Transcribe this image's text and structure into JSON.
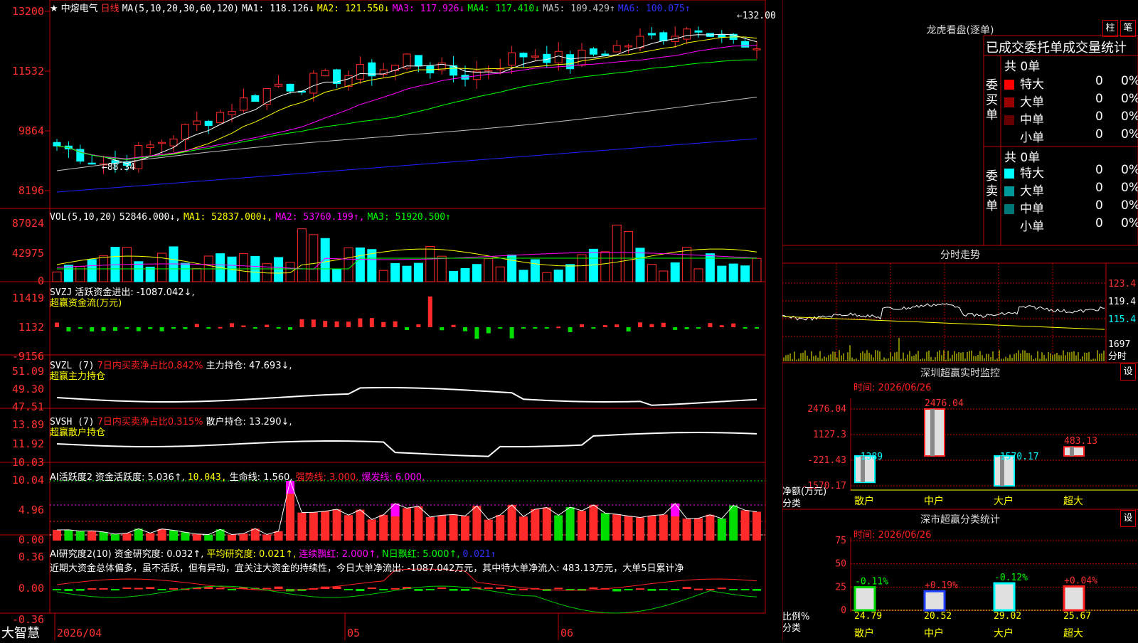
{
  "colors": {
    "up": "#ff2a2a",
    "down": "#00ffff",
    "green": "#00dd00",
    "grid": "#c00000",
    "white": "#ffffff",
    "yellow": "#ffff00",
    "magenta": "#ff00ff",
    "blue": "#1a1aff"
  },
  "main": {
    "stock_name": "中熔电气",
    "period": "日线",
    "ma_label": "MA(5,10,20,30,60,120)",
    "ma": [
      {
        "name": "MA1:",
        "value": "118.126↓",
        "color": "#ffffff"
      },
      {
        "name": "MA2:",
        "value": "121.550↓",
        "color": "#ffff00"
      },
      {
        "name": "MA3:",
        "value": "117.926↓",
        "color": "#ff00ff"
      },
      {
        "name": "MA4:",
        "value": "117.410↓",
        "color": "#00ff00"
      },
      {
        "name": "MA5:",
        "value": "109.429↑",
        "color": "#c0c0c0"
      },
      {
        "name": "MA6:",
        "value": "100.075↑",
        "color": "#3030ff"
      }
    ],
    "y_ticks": [
      "13200",
      "11532",
      "9864",
      "8196"
    ],
    "high_label": "132.00",
    "low_label": "88.34"
  },
  "vol": {
    "label": "VOL(5,10,20)",
    "value": "52846.000↓,",
    "ma1": "MA1: 52837.000↓,",
    "ma2": "MA2: 53760.199↑,",
    "ma3": "MA3: 51920.500↑",
    "y_ticks": [
      "87024",
      "42975",
      "0"
    ]
  },
  "svzj": {
    "label": "SVZJ",
    "desc": "活跃资金进出: -1087.042↓,",
    "sub": "超赢资金流(万元)",
    "y_ticks": [
      "11419",
      "1132",
      "-9156"
    ]
  },
  "svzl": {
    "label": "SVZL (7)",
    "desc": "7日内买卖净占比0.842%",
    "hold": "主力持仓: 47.693↓,",
    "sub": "超赢主力持仓",
    "y_ticks": [
      "51.09",
      "49.30",
      "47.51"
    ]
  },
  "svsh": {
    "label": "SVSH (7)",
    "desc": "7日内买卖净占比0.315%",
    "hold": "散户持仓: 13.290↓,",
    "sub": "超赢散户持仓",
    "y_ticks": [
      "13.89",
      "11.92",
      "10.03"
    ]
  },
  "ai1": {
    "label": "AI活跃度2",
    "desc": "资金活跃度: 5.036↑,",
    "v2": "10.043,",
    "life": "生命线: 1.560,",
    "strong": "强势线: 3.000,",
    "burst": "爆发线: 6.000,",
    "y_ticks": [
      "10.04",
      "4.96",
      "0.00"
    ]
  },
  "ai2": {
    "label": "AI研究度2(10)",
    "desc": "资金研究度: 0.032↑,",
    "avg": "平均研究度: 0.021↑,",
    "red": "连续飘红: 2.000↑,",
    "nred": "N日飘红: 5.000↑,",
    "last": "0.021↑",
    "text": "近期大资金总体偏多，虽不活跃，但有异动，宜关注大资金的持续性，今日大单净流出: -1087.042万元，其中特大单净流入: 483.13万元，大单5日累计净",
    "y_ticks": [
      "0.36",
      "0.00",
      "-0.36"
    ]
  },
  "xaxis": {
    "labels": [
      "2026/04",
      "05",
      "06"
    ]
  },
  "brand": "大智慧",
  "right": {
    "lhb_title": "龙虎看盘(逐单)",
    "tab_zhu": "柱",
    "tab_bi": "笔",
    "stats_header": "已成交委托单成交量统计",
    "buy_label": "委买单",
    "sell_label": "委卖单",
    "buy_total": "共 0单",
    "sell_total": "共 0单",
    "buy_rows": [
      {
        "name": "特大",
        "count": "0",
        "pct": "0%",
        "color": "#ff0000"
      },
      {
        "name": "大单",
        "count": "0",
        "pct": "0%",
        "color": "#990000"
      },
      {
        "name": "中单",
        "count": "0",
        "pct": "0%",
        "color": "#660000"
      },
      {
        "name": "小单",
        "count": "0",
        "pct": "0%",
        "color": ""
      }
    ],
    "sell_rows": [
      {
        "name": "特大",
        "count": "0",
        "pct": "0%",
        "color": "#00ffff"
      },
      {
        "name": "大单",
        "count": "0",
        "pct": "0%",
        "color": "#009999"
      },
      {
        "name": "中单",
        "count": "0",
        "pct": "0%",
        "color": "#007777"
      },
      {
        "name": "小单",
        "count": "0",
        "pct": "0%",
        "color": ""
      }
    ],
    "fs_title": "分时走势",
    "fs_ticks": [
      "123.4",
      "119.4",
      "115.4",
      "1697",
      "分时"
    ],
    "sz_title": "深圳超赢实时监控",
    "sz_time": "时间: 2026/06/26",
    "sz_yticks": [
      "2476.04",
      "1127.3",
      "-221.43",
      "-1570.17"
    ],
    "sz_ylabel": "净额(万元)",
    "sz_xlabel": "分类",
    "sz_bars": [
      {
        "cat": "散户",
        "value": -1389,
        "label": "-1389"
      },
      {
        "cat": "中户",
        "value": 2476.04,
        "label": "2476.04"
      },
      {
        "cat": "大户",
        "value": -1570.17,
        "label": "-1570.17"
      },
      {
        "cat": "超大",
        "value": 483.13,
        "label": "483.13"
      }
    ],
    "ss_title": "深市超赢分类统计",
    "ss_time": "时间: 2026/06/26",
    "ss_yticks": [
      "75",
      "50",
      "25",
      "0"
    ],
    "ss_ylabel": "比例%",
    "ss_xlabel": "分类",
    "ss_bars": [
      {
        "cat": "散户",
        "value": 24.79,
        "label": "24.79",
        "chg": "-0.11%"
      },
      {
        "cat": "中户",
        "value": 20.52,
        "label": "20.52",
        "chg": "+0.19%"
      },
      {
        "cat": "大户",
        "value": 29.02,
        "label": "29.02",
        "chg": "-0.12%"
      },
      {
        "cat": "超大",
        "value": 25.67,
        "label": "25.67",
        "chg": "+0.04%"
      }
    ],
    "set_btn": "设"
  }
}
